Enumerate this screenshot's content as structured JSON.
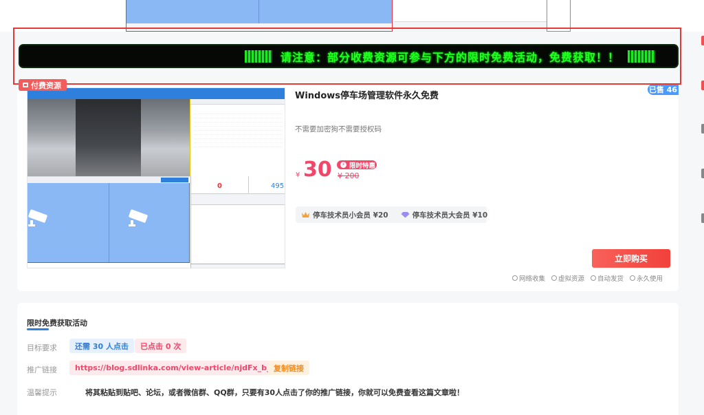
{
  "notice": {
    "text": "请注意：部分收费资源可参与下方的限时免费活动，免费获取！！"
  },
  "thumbnail": {
    "count_left": "0",
    "count_right": "495"
  },
  "product": {
    "badge": "付费资源",
    "title": "Windows停车场管理软件永久免费",
    "sold": "已售 46",
    "description": "不需要加密狗不需要授权码",
    "currency": "¥",
    "price": "30",
    "flash_label": "限时特惠",
    "old_price": "¥ 200",
    "vip_small": "停车技术员小会员 ¥20",
    "vip_big": "停车技术员大会员 ¥10",
    "buy_label": "立即购买",
    "features": [
      "网络收集",
      "虚拟资源",
      "自动发货",
      "永久使用"
    ]
  },
  "activity": {
    "title": "限时免费获取活动",
    "goal_label": "目标要求",
    "goal_need": "还需 30 人点击",
    "goal_done": "已点击 0 次",
    "link_label": "推广链接",
    "link_url": "https://blog.sdlinka.com/view-article/njdFx_b_",
    "copy_label": "复制链接",
    "tip_label": "温馨提示",
    "tip_text": "将其粘贴到贴吧、论坛，或者微信群、QQ群，只要有30人点击了你的推广链接，你就可以免费查看这篇文章啦！"
  },
  "colors": {
    "accent_red": "#f0476a",
    "accent_blue": "#2f7fdc",
    "ticker_green": "#22ff22"
  }
}
